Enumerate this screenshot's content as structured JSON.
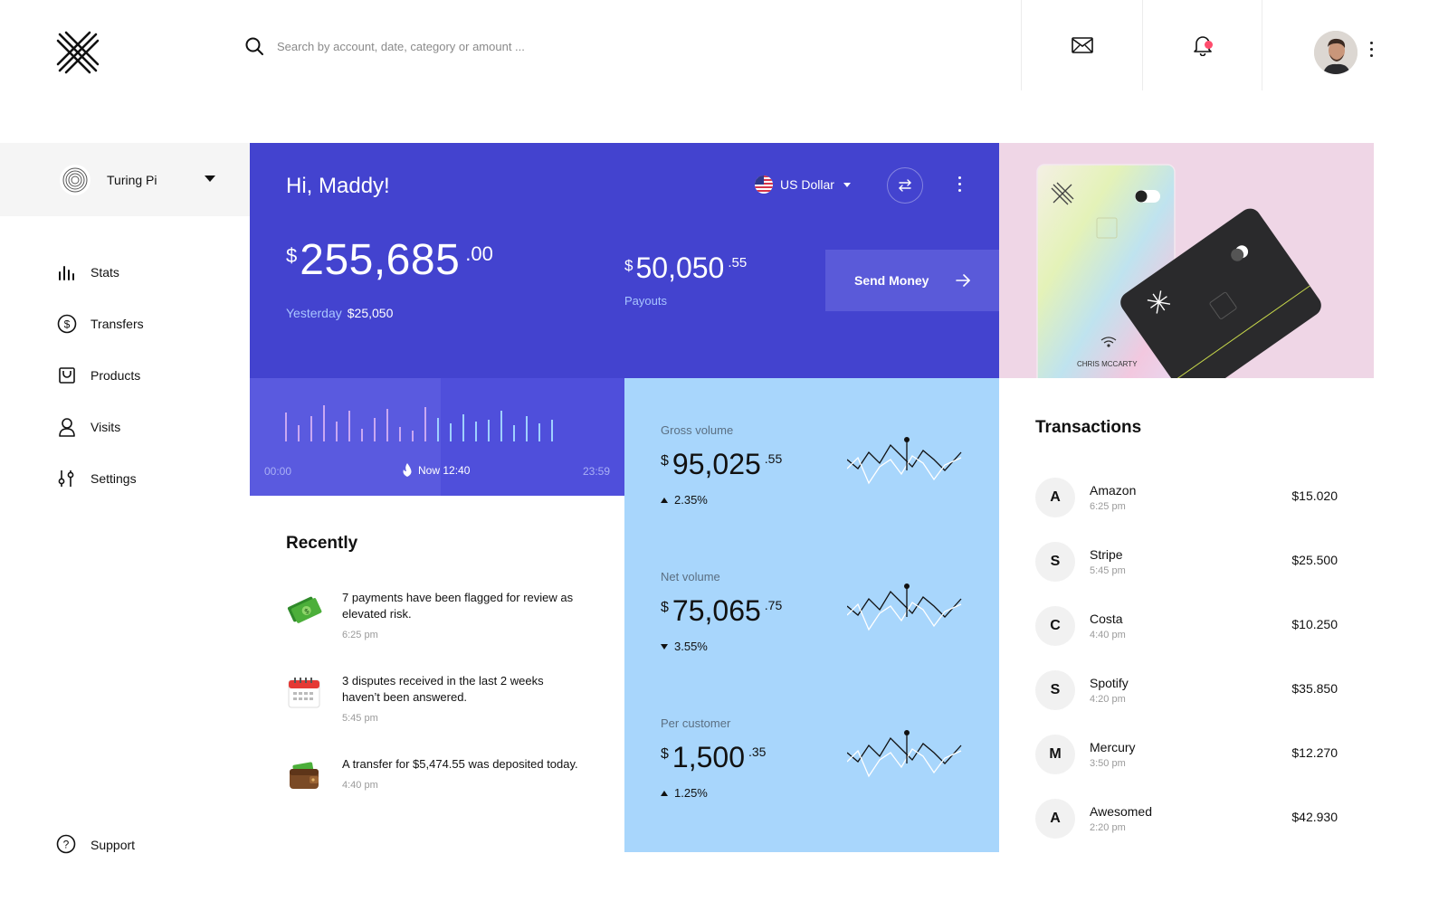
{
  "header": {
    "search_placeholder": "Search by account, date, category or amount ..."
  },
  "sidebar": {
    "org_name": "Turing Pi",
    "items": [
      {
        "label": "Stats",
        "icon": "bar-chart-icon"
      },
      {
        "label": "Transfers",
        "icon": "dollar-circle-icon"
      },
      {
        "label": "Products",
        "icon": "shopping-bag-icon"
      },
      {
        "label": "Visits",
        "icon": "user-icon"
      },
      {
        "label": "Settings",
        "icon": "sliders-icon"
      }
    ],
    "support_label": "Support"
  },
  "hero": {
    "greeting": "Hi, Maddy!",
    "currency_label": "US Dollar",
    "balance": {
      "currency": "$",
      "whole": "255,685",
      "decimal": ".00"
    },
    "yesterday_label": "Yesterday",
    "yesterday_value": "$25,050",
    "payouts": {
      "currency": "$",
      "whole": "50,050",
      "decimal": ".55",
      "label": "Payouts"
    },
    "send_money_label": "Send Money"
  },
  "card_art": {
    "cardholder": "CHRIS MCCARTY"
  },
  "timeline": {
    "start": "00:00",
    "now": "Now 12:40",
    "end": "23:59"
  },
  "metrics": [
    {
      "label": "Gross volume",
      "currency": "$",
      "whole": "95,025",
      "decimal": ".55",
      "change": "2.35%",
      "direction": "up"
    },
    {
      "label": "Net volume",
      "currency": "$",
      "whole": "75,065",
      "decimal": ".75",
      "change": "3.55%",
      "direction": "down"
    },
    {
      "label": "Per customer",
      "currency": "$",
      "whole": "1,500",
      "decimal": ".35",
      "change": "1.25%",
      "direction": "up"
    }
  ],
  "recently": {
    "title": "Recently",
    "items": [
      {
        "text": "7 payments have been flagged for review as elevated risk.",
        "time": "6:25 pm",
        "icon": "money-icon"
      },
      {
        "text": "3 disputes received in the last 2 weeks haven’t been answered.",
        "time": "5:45 pm",
        "icon": "calendar-icon"
      },
      {
        "text": "A transfer for $5,474.55 was deposited today.",
        "time": "4:40 pm",
        "icon": "wallet-icon"
      }
    ]
  },
  "transactions": {
    "title": "Transactions",
    "items": [
      {
        "initial": "A",
        "name": "Amazon",
        "time": "6:25 pm",
        "amount": "$15.020"
      },
      {
        "initial": "S",
        "name": "Stripe",
        "time": "5:45 pm",
        "amount": "$25.500"
      },
      {
        "initial": "C",
        "name": "Costa",
        "time": "4:40 pm",
        "amount": "$10.250"
      },
      {
        "initial": "S",
        "name": "Spotify",
        "time": "4:20 pm",
        "amount": "$35.850"
      },
      {
        "initial": "M",
        "name": "Mercury",
        "time": "3:50 pm",
        "amount": "$12.270"
      },
      {
        "initial": "A",
        "name": "Awesomed",
        "time": "2:20 pm",
        "amount": "$42.930"
      }
    ]
  },
  "colors": {
    "hero_blue": "#4343cf",
    "metrics_bg": "#a8d6fc",
    "cards_bg": "#efd6e6",
    "notification": "#ff4d6d"
  }
}
